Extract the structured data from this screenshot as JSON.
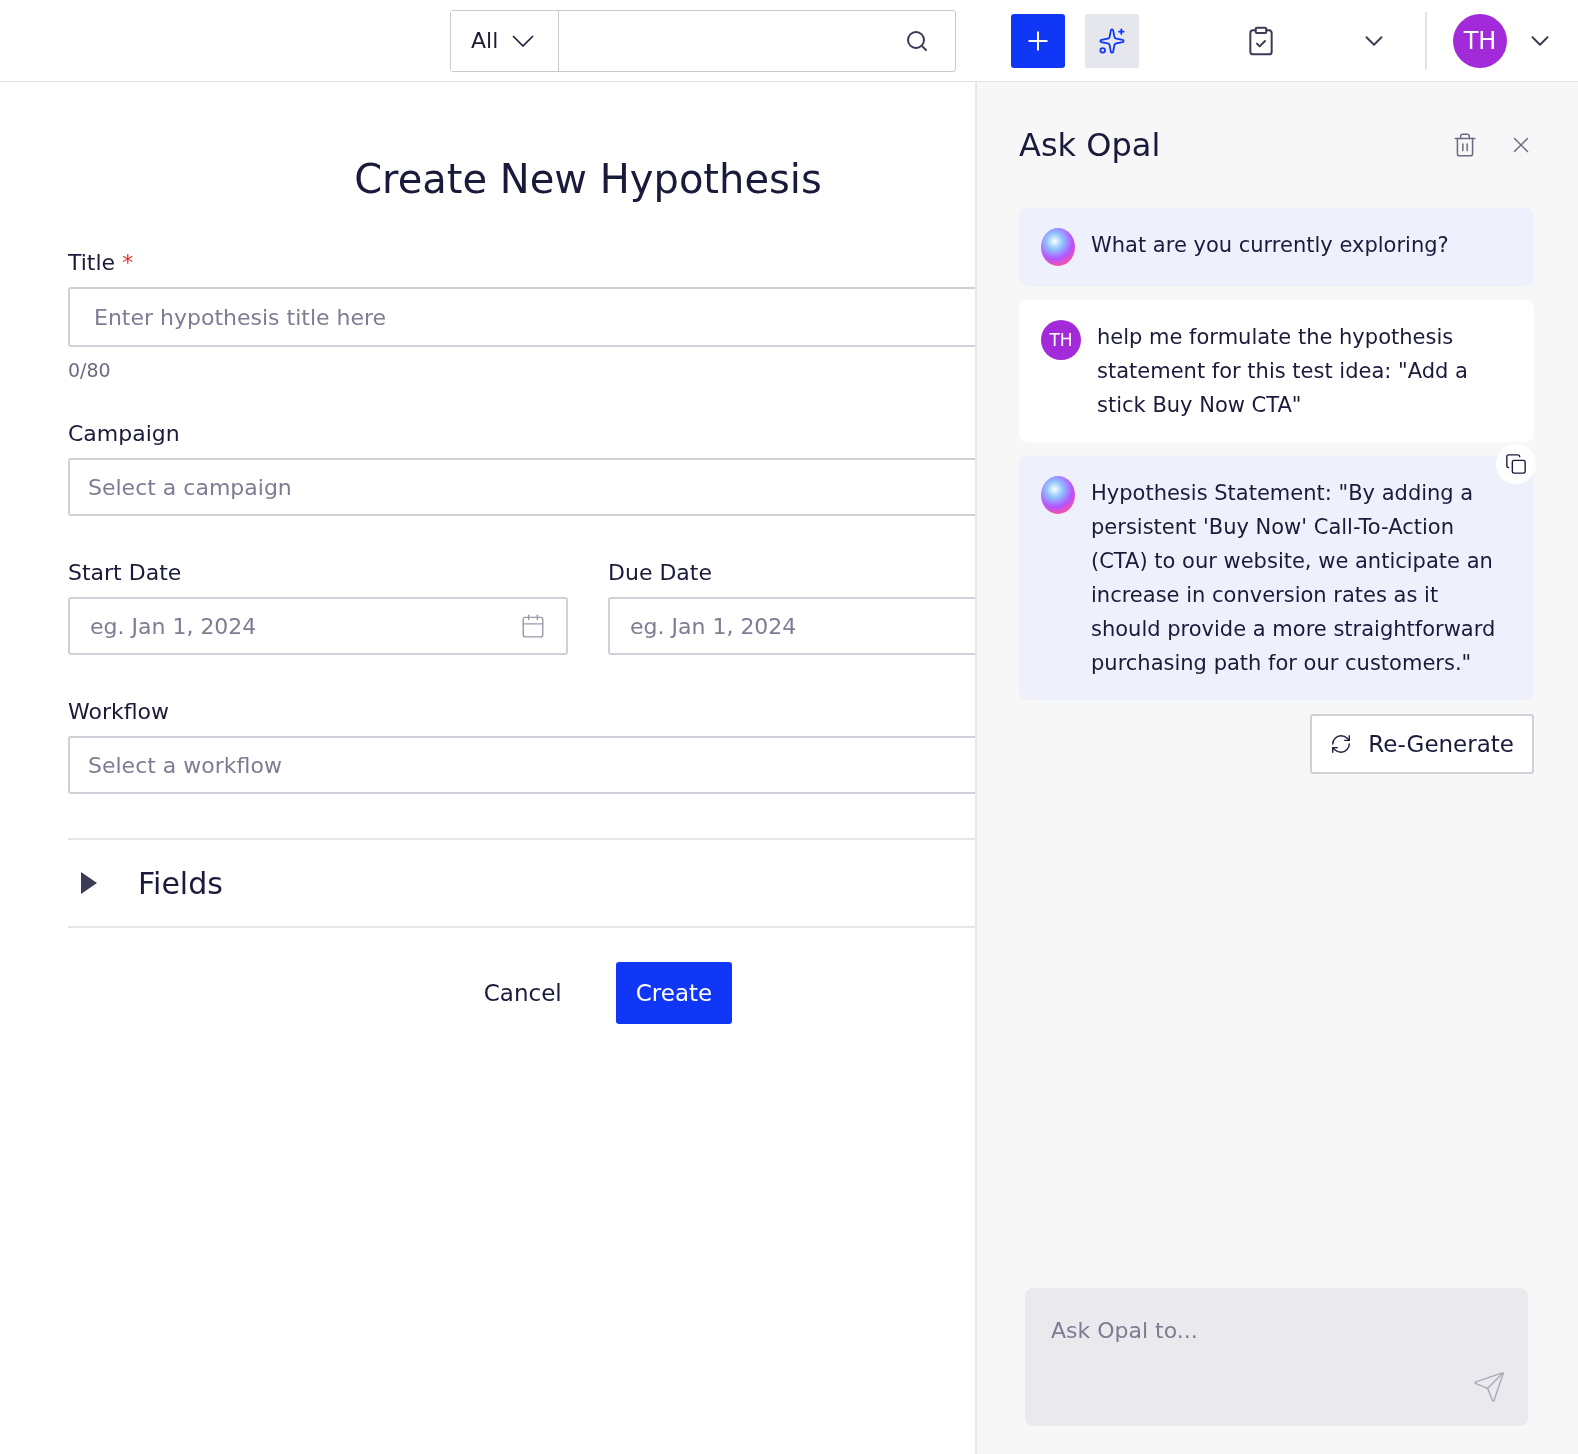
{
  "topbar": {
    "scope": {
      "label": "All"
    },
    "avatar": "TH"
  },
  "form": {
    "heading": "Create New Hypothesis",
    "title": {
      "label": "Title",
      "required_mark": "*",
      "placeholder": "Enter hypothesis title here",
      "counter": "0/80"
    },
    "campaign": {
      "label": "Campaign",
      "placeholder": "Select a campaign"
    },
    "start_date": {
      "label": "Start Date",
      "placeholder": "eg. Jan 1, 2024"
    },
    "due_date": {
      "label": "Due Date",
      "placeholder": "eg. Jan 1, 2024"
    },
    "workflow": {
      "label": "Workflow",
      "placeholder": "Select a workflow"
    },
    "fields_section": {
      "label": "Fields",
      "expanded": false
    },
    "buttons": {
      "cancel": "Cancel",
      "create": "Create"
    }
  },
  "assistant": {
    "title": "Ask Opal",
    "messages": [
      {
        "kind": "assistant",
        "text": "What are you currently exploring?",
        "copyable": false
      },
      {
        "kind": "user",
        "avatar": "TH",
        "text": "help me formulate the hypothesis statement for this test idea: \"Add a stick Buy Now CTA\"",
        "copyable": false
      },
      {
        "kind": "assistant",
        "text": "Hypothesis Statement: \"By adding a persistent 'Buy Now' Call-To-Action (CTA) to our website, we anticipate an increase in conversion rates as it should provide a more straightforward purchasing path for our customers.\"",
        "copyable": true
      }
    ],
    "regenerate": "Re-Generate",
    "input": {
      "placeholder": "Ask Opal to..."
    }
  }
}
